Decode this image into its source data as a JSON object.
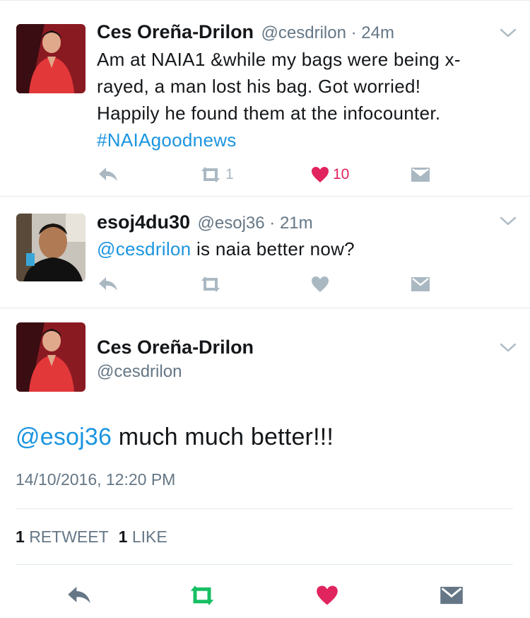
{
  "colors": {
    "link": "#1b95e0",
    "muted": "#657786",
    "icon_gray": "#aab8c2",
    "like_red": "#e0245e",
    "retweet_green": "#17bf63",
    "dark_icon": "#657786"
  },
  "tweets": [
    {
      "name": "Ces Oreña-Drilon",
      "handle": "@cesdrilon",
      "dot": " · ",
      "time": "24m",
      "text_lines": [
        "Am at NAIA1 &while my bags were being x-",
        "rayed, a man lost his bag. Got worried!",
        "Happily he found them at the infocounter."
      ],
      "hashtag": "#NAIAgoodnews",
      "retweets": "1",
      "likes": "10",
      "liked": true
    },
    {
      "name": "esoj4du30",
      "handle": "@esoj36",
      "dot": " · ",
      "time": "21m",
      "mention": "@cesdrilon",
      "text": " is naia better now?",
      "retweets": "",
      "likes": "",
      "liked": false
    }
  ],
  "focused": {
    "name": "Ces Oreña-Drilon",
    "handle": "@cesdrilon",
    "mention": "@esoj36",
    "text": " much much better!!!",
    "timestamp": "14/10/2016, 12:20 PM",
    "retweet_count": "1",
    "retweet_label": "RETWEET",
    "like_count": "1",
    "like_label": "LIKE"
  }
}
